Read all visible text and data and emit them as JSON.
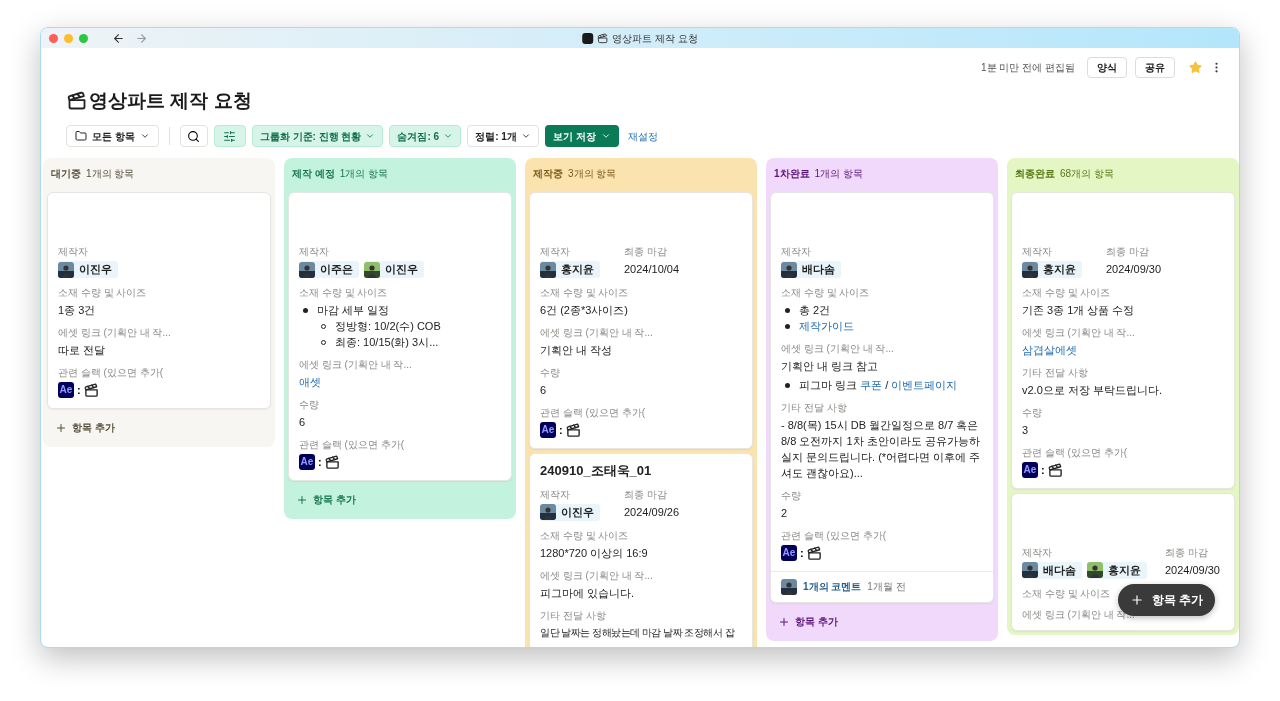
{
  "window": {
    "title": "영상파트 제작 요청"
  },
  "header": {
    "edited": "1분 미만 전에 편집됨",
    "buttons": [
      "양식",
      "공유"
    ],
    "favorite": true
  },
  "page": {
    "title": "영상파트 제작 요청"
  },
  "toolbar": {
    "view": "모든 항목",
    "filter_active": true,
    "chips": [
      {
        "label": "그룹화 기준: 진행 현황",
        "active": true
      },
      {
        "label": "숨겨짐: 6",
        "active": true
      },
      {
        "label": "정렬: 1개",
        "active": false
      }
    ],
    "save": "보기 저장",
    "reset": "재설정"
  },
  "columns": [
    {
      "name": "대기중",
      "count": "1개의 항목",
      "color": "#f7f6f3",
      "add": "항목 추가",
      "cards": [
        {
          "makers": {
            "label": "제작자",
            "people": [
              {
                "name": "이진우"
              }
            ]
          },
          "fields": [
            {
              "kind": "text",
              "label": "소재 수량 및 사이즈",
              "value": "1종 3건"
            },
            {
              "kind": "text",
              "label": "에셋 링크 (기획안 내 작...",
              "value": "따로 전달"
            },
            {
              "kind": "slack",
              "label": "관련 슬랙 (있으면 추가(",
              "app": "Ae",
              "sep": ":"
            }
          ]
        }
      ]
    },
    {
      "name": "제작 예정",
      "count": "1개의 항목",
      "color": "#c3f3de",
      "add": "항목 추가",
      "cards": [
        {
          "makers": {
            "label": "제작자",
            "people": [
              {
                "name": "이주은"
              },
              {
                "name": "이진우"
              }
            ]
          },
          "fields": [
            {
              "kind": "text",
              "label": "소재 수량 및 사이즈",
              "bullets": [
                {
                  "parts": [
                    {
                      "text": "마감 세부 일정"
                    }
                  ],
                  "children": [
                    {
                      "parts": [
                        {
                          "text": "정방형: 10/2(수) COB"
                        }
                      ]
                    },
                    {
                      "parts": [
                        {
                          "text": "최종: 10/15(화) 3시..."
                        }
                      ]
                    }
                  ]
                }
              ]
            },
            {
              "kind": "text",
              "label": "에셋 링크 (기획안 내 작...",
              "value": "애셋",
              "link": true
            },
            {
              "kind": "text",
              "label": "수량",
              "value": "6"
            },
            {
              "kind": "slack",
              "label": "관련 슬랙 (있으면 추가(",
              "app": "Ae",
              "sep": ":"
            }
          ]
        }
      ]
    },
    {
      "name": "제작중",
      "count": "3개의 항목",
      "color": "#fbe3b0",
      "cards": [
        {
          "makers": {
            "label": "제작자",
            "people": [
              {
                "name": "홍지윤"
              }
            ]
          },
          "deadline": {
            "label": "최종 마감",
            "value": "2024/10/04"
          },
          "fields": [
            {
              "kind": "text",
              "label": "소재 수량 및 사이즈",
              "value": "6건 (2종*3사이즈)"
            },
            {
              "kind": "text",
              "label": "에셋 링크 (기획안 내 작...",
              "value": "기획안 내 작성"
            },
            {
              "kind": "text",
              "label": "수량",
              "value": "6"
            },
            {
              "kind": "slack",
              "label": "관련 슬랙 (있으면 추가(",
              "app": "Ae",
              "sep": ":"
            }
          ]
        },
        {
          "title": "240910_조태욱_01",
          "makers": {
            "label": "제작자",
            "people": [
              {
                "name": "이진우"
              }
            ]
          },
          "deadline": {
            "label": "최종 마감",
            "value": "2024/09/26"
          },
          "fields": [
            {
              "kind": "text",
              "label": "소재 수량 및 사이즈",
              "value": "1280*720 이상의 16:9"
            },
            {
              "kind": "text",
              "label": "에셋 링크 (기획안 내 작...",
              "value": "피그마에 있습니다."
            },
            {
              "kind": "text",
              "label": "기타 전달 사항",
              "value": "일단 날짜는 정해놨는데 마감 날짜 조정해서 잡",
              "nowrap": true
            }
          ]
        }
      ]
    },
    {
      "name": "1차완료",
      "count": "1개의 항목",
      "color": "#f1d9fb",
      "add": "항목 추가",
      "cards": [
        {
          "makers": {
            "label": "제작자",
            "people": [
              {
                "name": "배다솜"
              }
            ]
          },
          "fields": [
            {
              "kind": "text",
              "label": "소재 수량 및 사이즈",
              "bullets": [
                {
                  "parts": [
                    {
                      "text": "총 2건"
                    }
                  ]
                },
                {
                  "parts": [
                    {
                      "text": "제작가이드",
                      "link": true
                    }
                  ]
                }
              ]
            },
            {
              "kind": "text",
              "label": "에셋 링크 (기획안 내 작...",
              "value": "기획안 내 링크 참고",
              "bullets": [
                {
                  "parts": [
                    {
                      "text": "피그마 링크 "
                    },
                    {
                      "text": "쿠폰",
                      "link": true
                    },
                    {
                      "text": " / "
                    },
                    {
                      "text": "이벤트페이지",
                      "link": true
                    }
                  ]
                }
              ]
            },
            {
              "kind": "text",
              "label": "기타 전달 사항",
              "value": "- 8/8(목) 15시 DB 월간일정으로 8/7 혹은 8/8 오전까지 1차 초안이라도 공유가능하실지 문의드립니다. (*어렵다면 이후에 주셔도 괜찮아요)..."
            },
            {
              "kind": "text",
              "label": "수량",
              "value": "2"
            },
            {
              "kind": "slack",
              "label": "관련 슬랙 (있으면 추가(",
              "app": "Ae",
              "sep": ":"
            }
          ],
          "comment": {
            "count": "1개의 코멘트",
            "time": "1개월 전"
          }
        }
      ]
    },
    {
      "name": "최종완료",
      "count": "68개의 항목",
      "color": "#e4f6c3",
      "cards": [
        {
          "makers": {
            "label": "제작자",
            "people": [
              {
                "name": "홍지윤"
              }
            ]
          },
          "deadline": {
            "label": "최종 마감",
            "value": "2024/09/30"
          },
          "fields": [
            {
              "kind": "text",
              "label": "소재 수량 및 사이즈",
              "value": "기존 3종 1개 상품 수정"
            },
            {
              "kind": "text",
              "label": "에셋 링크 (기획안 내 작...",
              "value": "삼겹살에셋",
              "link": true
            },
            {
              "kind": "text",
              "label": "기타 전달 사항",
              "value": "v2.0으로 저장 부탁드립니다."
            },
            {
              "kind": "text",
              "label": "수량",
              "value": "3"
            },
            {
              "kind": "slack",
              "label": "관련 슬랙 (있으면 추가(",
              "app": "Ae",
              "sep": ":"
            }
          ]
        },
        {
          "makers": {
            "label": "제작자",
            "people": [
              {
                "name": "배다솜"
              },
              {
                "name": "홍지윤"
              }
            ]
          },
          "deadline": {
            "label": "최종 마감",
            "value": "2024/09/30"
          },
          "fields": [
            {
              "kind": "text",
              "label": "소재 수량 및 사이즈"
            },
            {
              "kind": "text",
              "label": "에셋 링크 (기획안 내 작..."
            }
          ]
        }
      ]
    }
  ],
  "fab": {
    "label": "항목 추가"
  }
}
